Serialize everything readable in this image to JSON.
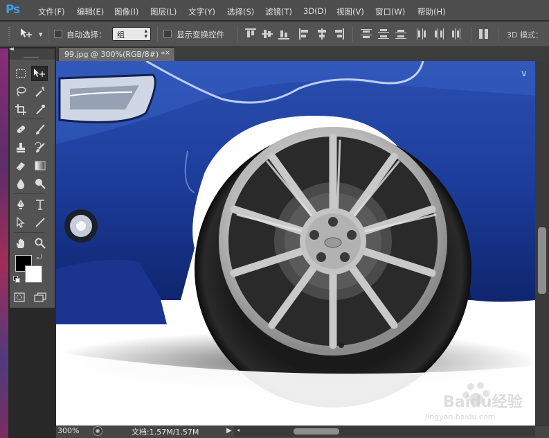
{
  "app": {
    "logo": "Ps",
    "accent": "#3da0e6"
  },
  "menu": [
    "文件(F)",
    "编辑(E)",
    "图像(I)",
    "图层(L)",
    "文字(Y)",
    "选择(S)",
    "滤镜(T)",
    "3D(D)",
    "视图(V)",
    "窗口(W)",
    "帮助(H)"
  ],
  "options": {
    "tool_icon": "move-tool-icon",
    "auto_select_label": "自动选择：",
    "auto_select_checked": false,
    "auto_select_value": "组",
    "show_transform_label": "显示变换控件",
    "show_transform_checked": false,
    "mode3d_label": "3D 模式："
  },
  "toolbox": {
    "tools": [
      "rectangular-marquee-icon",
      "move-tool-icon",
      "lasso-icon",
      "magic-wand-icon",
      "crop-icon",
      "eyedropper-icon",
      "healing-brush-icon",
      "brush-icon",
      "clone-stamp-icon",
      "history-brush-icon",
      "eraser-icon",
      "gradient-icon",
      "blur-icon",
      "dodge-icon",
      "pen-icon",
      "type-icon",
      "path-selection-icon",
      "line-icon",
      "hand-icon",
      "zoom-icon"
    ],
    "foreground_color": "#000000",
    "background_color": "#ffffff"
  },
  "document": {
    "tab_title": "99.jpg @ 300%(RGB/8#) *",
    "close_glyph": "×"
  },
  "status": {
    "zoom": "300%",
    "doc_info": "文档:1.57M/1.57M"
  },
  "watermark": {
    "brand": "Bai",
    "brand2": "du",
    "brand3": "经验",
    "url": "jingyan.baidu.com"
  }
}
